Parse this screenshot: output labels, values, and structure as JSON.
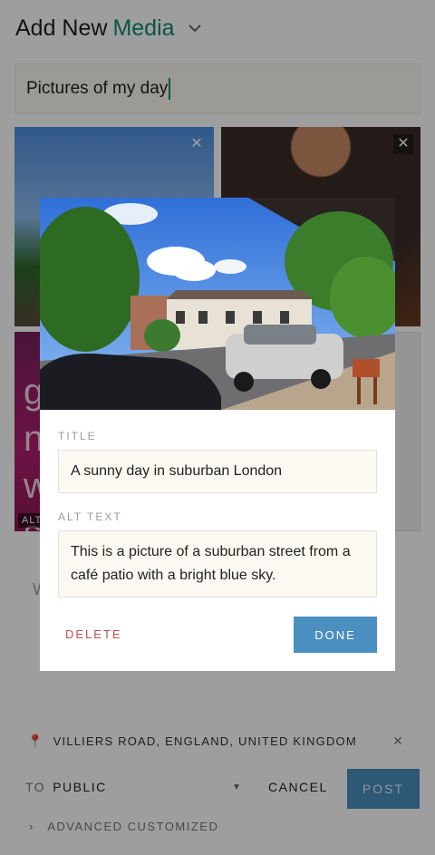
{
  "header": {
    "title_prefix": "Add New",
    "title_accent": "Media"
  },
  "caption": {
    "value": "Pictures of my day"
  },
  "thumbs": {
    "alt_badge": "ALT",
    "text_fragment": "g\nn\nw\ns"
  },
  "hint_text": "W",
  "location": {
    "text": "VILLIERS ROAD, ENGLAND, UNITED KINGDOM"
  },
  "footer": {
    "to_label": "TO",
    "visibility": "PUBLIC",
    "cancel_label": "CANCEL",
    "post_label": "POST",
    "advanced_label": "ADVANCED CUSTOMIZED"
  },
  "modal": {
    "title_label": "TITLE",
    "title_value": "A sunny day in suburban London",
    "alt_label": "ALT TEXT",
    "alt_value": "This is a picture of a suburban street from a café patio with a bright blue sky.",
    "delete_label": "DELETE",
    "done_label": "DONE"
  },
  "colors": {
    "accent": "#0f8a73",
    "primary_button": "#4a8fbf",
    "danger": "#c0504d"
  }
}
